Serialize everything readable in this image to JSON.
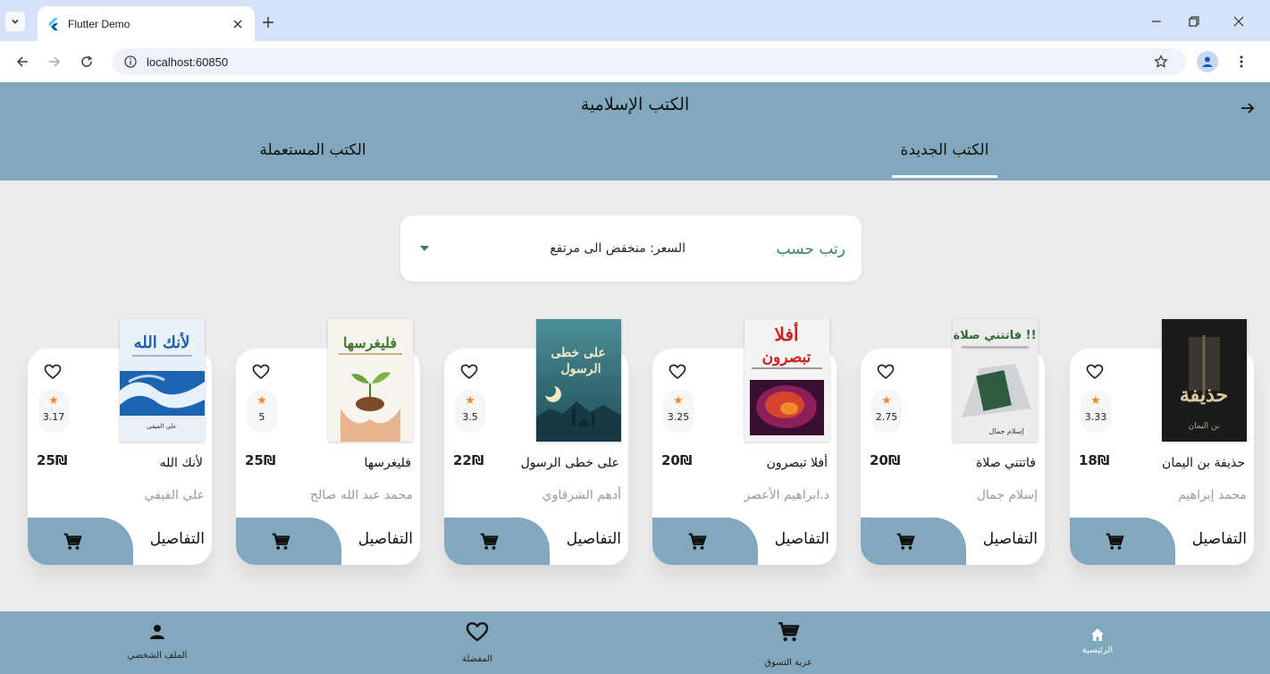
{
  "browser": {
    "tab_title": "Flutter Demo",
    "url": "localhost:60850"
  },
  "app": {
    "title": "الكتب الإسلامية",
    "tabs": [
      {
        "label": "الكتب الجديدة",
        "active": true
      },
      {
        "label": "الكتب المستعملة",
        "active": false
      }
    ],
    "sort": {
      "label": "رتب حسب",
      "value": "السعر: منخفض الى مرتفع"
    },
    "details_label": "التفاصيل",
    "books": [
      {
        "title": "حذيفة بن اليمان",
        "author": "محمد إبراهيم",
        "price": "18₪",
        "rating": "3.33",
        "cover": {
          "bg": "#1c1b19",
          "accent": "#d7c9a6",
          "text": "حذيفة"
        }
      },
      {
        "title": "فاتتني صلاة",
        "author": "إسلام جمال",
        "price": "20₪",
        "rating": "2.75",
        "cover": {
          "bg": "#ececec",
          "accent": "#2f6b3a",
          "text": "فاتتني صلاة !!"
        }
      },
      {
        "title": "أفلا تبصرون",
        "author": "د.ابراهيم الأعصر",
        "price": "20₪",
        "rating": "3.25",
        "cover": {
          "bg": "#f3f3f3",
          "accent": "#c9231f",
          "text": "أفلا تبصرون"
        }
      },
      {
        "title": "على خطى الرسول",
        "author": "أدهم الشرقاوي",
        "price": "22₪",
        "rating": "3.5",
        "cover": {
          "bg": "#2d6f7a",
          "accent": "#f2e9c9",
          "text": "على خطى الرسول"
        }
      },
      {
        "title": "فليغرسها",
        "author": "محمد عبد الله صالح",
        "price": "25₪",
        "rating": "5",
        "cover": {
          "bg": "#f7f4ee",
          "accent": "#3c7a2e",
          "text": "فليغرسها"
        }
      },
      {
        "title": "لأنك الله",
        "author": "علي الفيفي",
        "price": "25₪",
        "rating": "3.17",
        "cover": {
          "bg": "#e9f1f8",
          "accent": "#1f5fae",
          "text": "لأنك الله"
        }
      }
    ],
    "bottom_nav": [
      {
        "label": "الرئيسية",
        "icon": "home-icon",
        "active": true
      },
      {
        "label": "عربة التسوق",
        "icon": "cart-icon",
        "active": false
      },
      {
        "label": "المفضلة",
        "icon": "heart-icon",
        "active": false
      },
      {
        "label": "الملف الشخصي",
        "icon": "person-icon",
        "active": false
      }
    ]
  },
  "colors": {
    "appbar": "#81a8bd",
    "rating_star": "#f08a24",
    "sort_label": "#2f7f7a"
  }
}
